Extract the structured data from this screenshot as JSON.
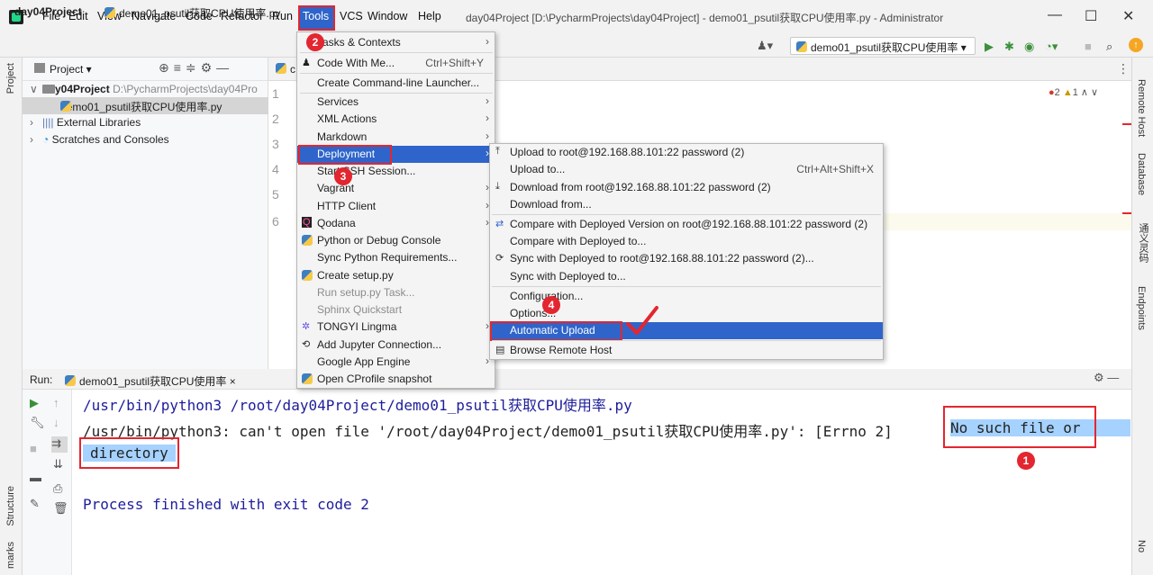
{
  "menubar": {
    "items": [
      "File",
      "Edit",
      "View",
      "Navigate",
      "Code",
      "Refactor",
      "Run",
      "Tools",
      "VCS",
      "Window",
      "Help"
    ],
    "window_title": "day04Project [D:\\PycharmProjects\\day04Project] - demo01_psutil获取CPU使用率.py - Administrator",
    "min": "—",
    "max": "☐",
    "close": "✕"
  },
  "navbar": {
    "project": "day04Project",
    "file": "demo01_psutil获取CPU使用率.py",
    "run_config": "demo01_psutil获取CPU使用率 ▾"
  },
  "project_panel": {
    "title": "Project ▾",
    "root_name": "day04Project",
    "root_path": "D:\\PycharmProjects\\day04Pro",
    "file": "demo01_psutil获取CPU使用率.py",
    "external": "External Libraries",
    "scratches": "Scratches and Consoles"
  },
  "left_stripe": {
    "project": "Project",
    "structure": "Structure",
    "bookmarks": "marks"
  },
  "editor": {
    "tab_label": "c",
    "line_numbers": [
      "1",
      "2",
      "3",
      "4",
      "5",
      "6"
    ],
    "errors": "2",
    "warnings": "1"
  },
  "right_stripe": {
    "remote_host": "Remote Host",
    "database": "Database",
    "lingma": "通义灵码",
    "endpoints": "Endpoints",
    "notifications": "No"
  },
  "tools_menu": {
    "items": [
      {
        "label": "Tasks & Contexts",
        "arrow": true
      },
      {
        "label": "Code With Me...",
        "shortcut": "Ctrl+Shift+Y"
      },
      {
        "label": "Create Command-line Launcher..."
      },
      {
        "label": "Services",
        "arrow": true
      },
      {
        "label": "XML Actions",
        "arrow": true
      },
      {
        "label": "Markdown",
        "arrow": true
      },
      {
        "label": "Deployment",
        "arrow": true
      },
      {
        "label": "Start SSH Session..."
      },
      {
        "label": "Vagrant",
        "arrow": true
      },
      {
        "label": "HTTP Client",
        "arrow": true
      },
      {
        "label": "Qodana",
        "arrow": true
      },
      {
        "label": "Python or Debug Console"
      },
      {
        "label": "Sync Python Requirements..."
      },
      {
        "label": "Create setup.py"
      },
      {
        "label": "Run setup.py Task..."
      },
      {
        "label": "Sphinx Quickstart"
      },
      {
        "label": "TONGYI Lingma",
        "arrow": true
      },
      {
        "label": "Add Jupyter Connection..."
      },
      {
        "label": "Google App Engine",
        "arrow": true
      },
      {
        "label": "Open CProfile snapshot"
      }
    ]
  },
  "deploy_menu": {
    "items": [
      {
        "label": "Upload to root@192.168.88.101:22 password (2)"
      },
      {
        "label": "Upload to...",
        "shortcut": "Ctrl+Alt+Shift+X"
      },
      {
        "label": "Download from root@192.168.88.101:22 password (2)"
      },
      {
        "label": "Download from..."
      },
      {
        "label": "Compare with Deployed Version on root@192.168.88.101:22 password (2)"
      },
      {
        "label": "Compare with Deployed to..."
      },
      {
        "label": "Sync with Deployed to root@192.168.88.101:22 password (2)..."
      },
      {
        "label": "Sync with Deployed to..."
      },
      {
        "label": "Configuration..."
      },
      {
        "label": "Options..."
      },
      {
        "label": "Automatic Upload"
      },
      {
        "label": "Browse Remote Host"
      }
    ]
  },
  "run_panel": {
    "label": "Run:",
    "tab": "demo01_psutil获取CPU使用率 ×",
    "lines": [
      "/usr/bin/python3 /root/day04Project/demo01_psutil获取CPU使用率.py",
      "/usr/bin/python3: can't open file '/root/day04Project/demo01_psutil获取CPU使用率.py': [Errno 2] ",
      "No such file or",
      "directory",
      "Process finished with exit code 2"
    ]
  },
  "annotations": {
    "badge1": "1",
    "badge2": "2",
    "badge3": "3",
    "badge4": "4"
  }
}
